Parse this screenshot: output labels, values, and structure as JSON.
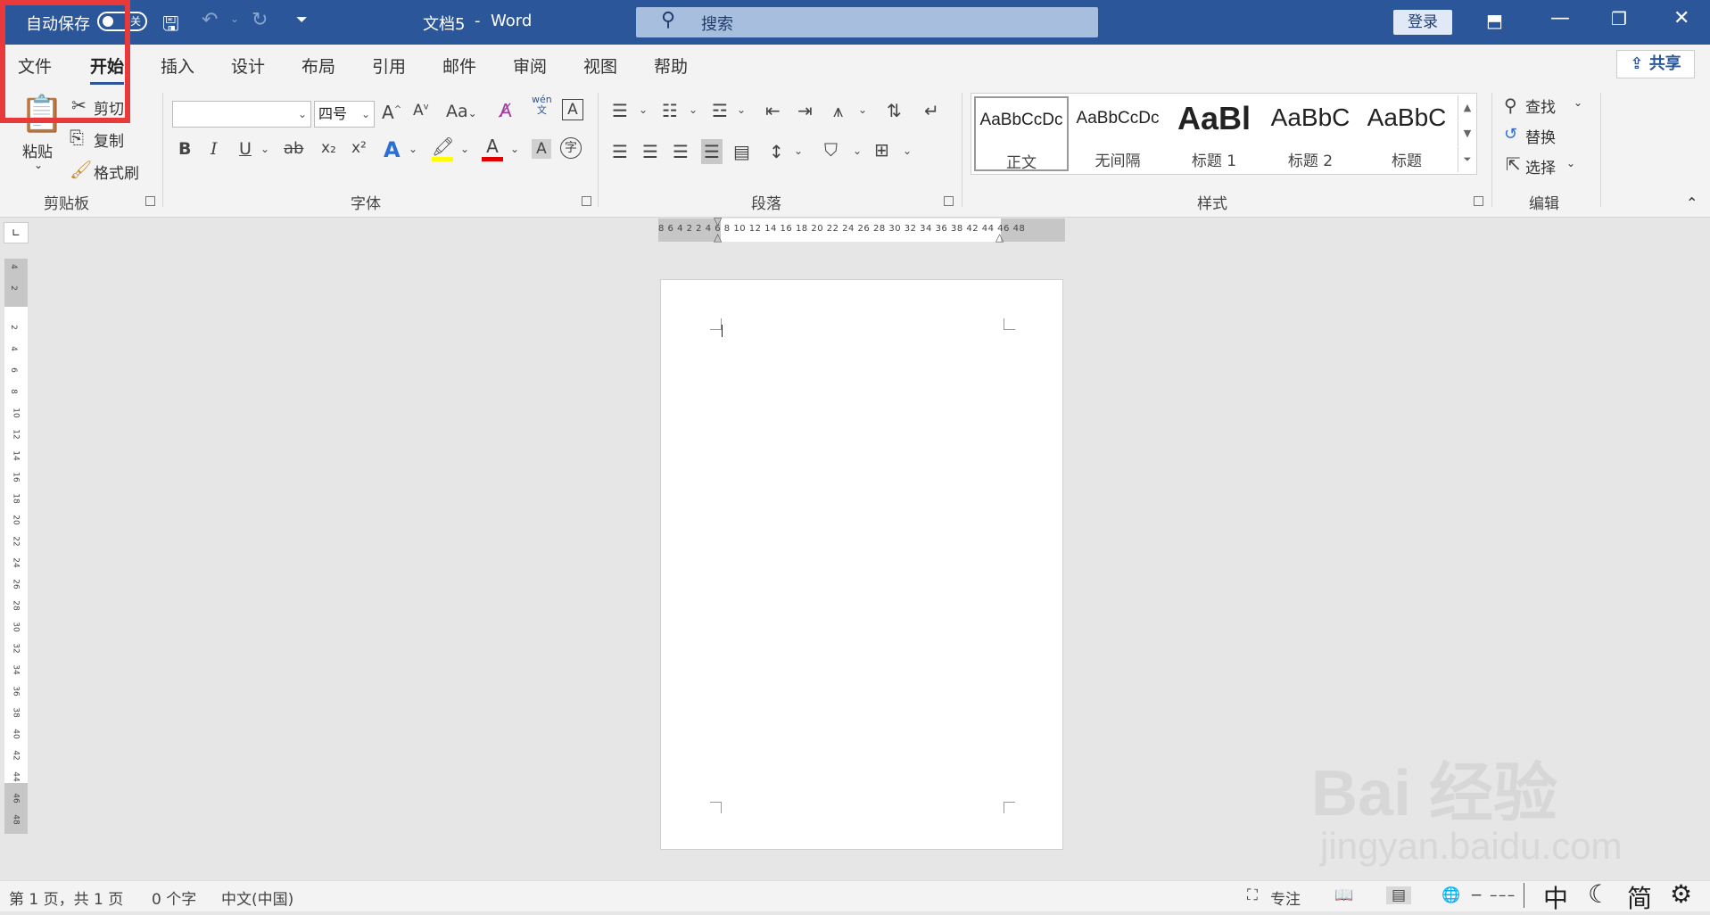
{
  "titlebar": {
    "autosave_label": "自动保存",
    "autosave_state": "关",
    "doc_title": "文档5",
    "separator": "-",
    "app_name": "Word",
    "search_placeholder": "搜索",
    "login_label": "登录"
  },
  "tabs": [
    "文件",
    "开始",
    "插入",
    "设计",
    "布局",
    "引用",
    "邮件",
    "审阅",
    "视图",
    "帮助"
  ],
  "active_tab": "开始",
  "share_label": "共享",
  "clipboard": {
    "paste": "粘贴",
    "cut": "剪切",
    "copy": "复制",
    "format_painter": "格式刷",
    "group_label": "剪贴板"
  },
  "font": {
    "font_name": "",
    "font_size": "四号",
    "group_label": "字体",
    "phonetic_top": "wén",
    "phonetic_bottom": "文",
    "bold": "B",
    "italic": "I",
    "underline": "U",
    "strike": "ab",
    "subscript": "x₂",
    "superscript": "x²",
    "case": "Aa",
    "grow": "A",
    "shrink": "A",
    "char_border": "A",
    "enclose": "字",
    "shading": "A"
  },
  "paragraph": {
    "group_label": "段落"
  },
  "styles": {
    "group_label": "样式",
    "items": [
      {
        "sample": "AaBbCcDc",
        "name": "正文"
      },
      {
        "sample": "AaBbCcDc",
        "name": "无间隔"
      },
      {
        "sample": "AaBl",
        "name": "标题 1"
      },
      {
        "sample": "AaBbC",
        "name": "标题 2"
      },
      {
        "sample": "AaBbC",
        "name": "标题"
      }
    ]
  },
  "editing": {
    "find": "查找",
    "replace": "替换",
    "select": "选择",
    "group_label": "编辑"
  },
  "ruler": {
    "horizontal": "8 6 4 2    2 4 6 8 10 12 14 16 18 20 22 24 26 28 30 32 34 36 38    42 44 46 48",
    "vertical": [
      "4",
      "2",
      "",
      "2",
      "4",
      "6",
      "8",
      "10",
      "12",
      "14",
      "16",
      "18",
      "20",
      "22",
      "24",
      "26",
      "28",
      "30",
      "32",
      "34",
      "36",
      "38",
      "40",
      "42",
      "44",
      "46",
      "48"
    ]
  },
  "status": {
    "page": "第 1 页，共 1 页",
    "words": "0 个字",
    "language": "中文(中国)",
    "focus": "专注",
    "ime_lang": "中",
    "ime_mode": "简"
  },
  "watermark": {
    "brand": "Bai 经验",
    "url": "jingyan.baidu.com"
  },
  "colors": {
    "titlebar": "#2b579a",
    "highlight_box": "#e83a3a",
    "highlight_yellow": "#ffff00",
    "font_color_red": "#e00000"
  }
}
